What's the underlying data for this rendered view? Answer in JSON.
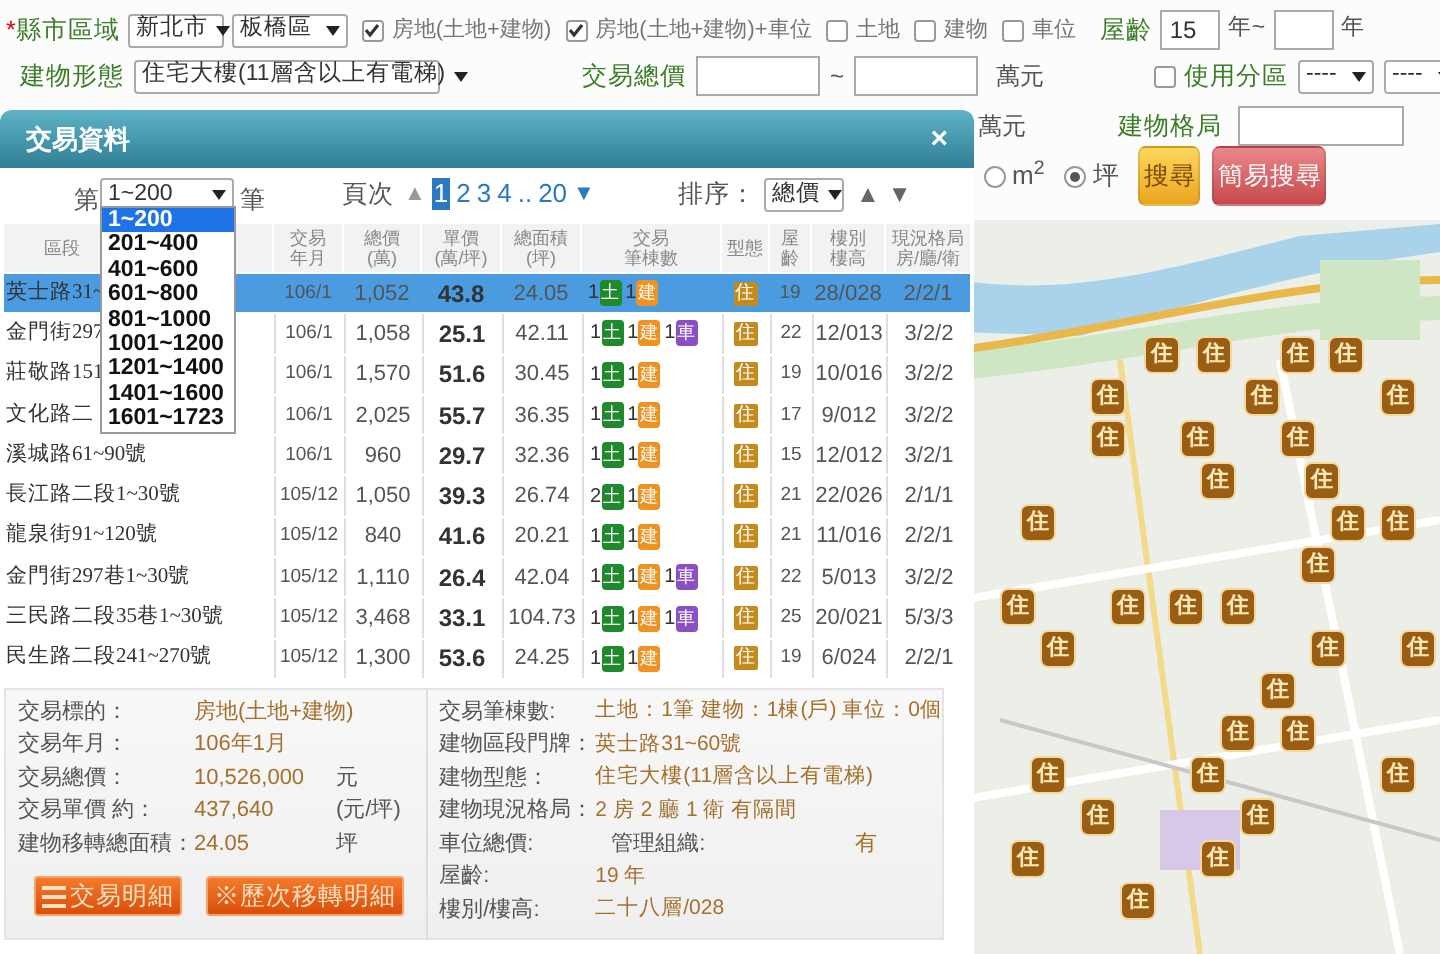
{
  "filters": {
    "region": {
      "label": "縣市區域",
      "required_mark": "*",
      "city": "新北市",
      "district": "板橋區"
    },
    "types": [
      {
        "label": "房地(土地+建物)",
        "checked": true
      },
      {
        "label": "房地(土地+建物)+車位",
        "checked": true
      },
      {
        "label": "土地",
        "checked": false
      },
      {
        "label": "建物",
        "checked": false
      },
      {
        "label": "車位",
        "checked": false
      }
    ],
    "age": {
      "label": "屋齡",
      "from": "15",
      "mid_unit": "年~",
      "unit": "年"
    },
    "building_type": {
      "label": "建物形態",
      "value": "住宅大樓(11層含以上有電梯)"
    },
    "total_price": {
      "label": "交易總價",
      "sep": "~",
      "unit": "萬元"
    },
    "zoning": {
      "label": "使用分區",
      "checked": false,
      "select_1": "----",
      "select_2": "----"
    },
    "hidden_unit": "萬元",
    "layout": {
      "label": "建物格局"
    },
    "area_units": [
      {
        "label": "m$^{2}$",
        "selected": false
      },
      {
        "label": "坪",
        "selected": true
      }
    ],
    "buttons": [
      {
        "label": "搜尋",
        "kind": "search"
      },
      {
        "label": "簡易搜尋",
        "kind": "simple"
      }
    ]
  },
  "panel": {
    "title": "交易資料",
    "close": "×",
    "range": {
      "prefix": "第",
      "value": "1~200",
      "suffix": "筆",
      "options": [
        {
          "label": "1~200",
          "selected": true
        },
        {
          "label": "201~400",
          "selected": false
        },
        {
          "label": "401~600",
          "selected": false
        },
        {
          "label": "601~800",
          "selected": false
        },
        {
          "label": "801~1000",
          "selected": false
        },
        {
          "label": "1001~1200",
          "selected": false
        },
        {
          "label": "1201~1400",
          "selected": false
        },
        {
          "label": "1401~1600",
          "selected": false
        },
        {
          "label": "1601~1723",
          "selected": false
        }
      ]
    },
    "pager": {
      "label": "頁次",
      "up": "▲",
      "down": "▼",
      "pages": [
        {
          "label": "1",
          "selected": true
        },
        {
          "label": "2",
          "selected": false
        },
        {
          "label": "3",
          "selected": false
        },
        {
          "label": "4",
          "selected": false
        },
        {
          "label": "..",
          "selected": false
        },
        {
          "label": "20",
          "selected": false
        }
      ]
    },
    "sort": {
      "label": "排序：",
      "value": "總價",
      "up": "▲",
      "down": "▼"
    },
    "table": {
      "columns": [
        {
          "lines": [
            "區段"
          ]
        },
        {
          "lines": [
            "交易",
            "年月"
          ]
        },
        {
          "lines": [
            "總價",
            "(萬)"
          ]
        },
        {
          "lines": [
            "單價",
            "(萬/坪)"
          ]
        },
        {
          "lines": [
            "總面積",
            "(坪)"
          ]
        },
        {
          "lines": [
            "交易",
            "筆棟數"
          ]
        },
        {
          "lines": [
            "型態"
          ]
        },
        {
          "lines": [
            "屋",
            "齡"
          ]
        },
        {
          "lines": [
            "樓別",
            "樓高"
          ]
        },
        {
          "lines": [
            "現況格局",
            "房/廳/衛"
          ]
        }
      ],
      "rows": [
        {
          "selected": true,
          "cells": [
            "英士路31~",
            "106/1",
            "1,052",
            "43.8",
            "24.05"
          ],
          "counts": [
            {
              "n": "1",
              "kind": "land",
              "label": "土"
            },
            {
              "n": "1",
              "kind": "building",
              "label": "建"
            }
          ],
          "type": "住",
          "rest": [
            "19",
            "28/028",
            "2/2/1"
          ]
        },
        {
          "selected": false,
          "cells": [
            "金門街297",
            "106/1",
            "1,058",
            "25.1",
            "42.11"
          ],
          "counts": [
            {
              "n": "1",
              "kind": "land",
              "label": "土"
            },
            {
              "n": "1",
              "kind": "building",
              "label": "建"
            },
            {
              "n": "1",
              "kind": "parking",
              "label": "車"
            }
          ],
          "type": "住",
          "rest": [
            "22",
            "12/013",
            "3/2/2"
          ]
        },
        {
          "selected": false,
          "cells": [
            "莊敬路151",
            "106/1",
            "1,570",
            "51.6",
            "30.45"
          ],
          "counts": [
            {
              "n": "1",
              "kind": "land",
              "label": "土"
            },
            {
              "n": "1",
              "kind": "building",
              "label": "建"
            }
          ],
          "type": "住",
          "rest": [
            "19",
            "10/016",
            "3/2/2"
          ]
        },
        {
          "selected": false,
          "cells": [
            "文化路二",
            "106/1",
            "2,025",
            "55.7",
            "36.35"
          ],
          "counts": [
            {
              "n": "1",
              "kind": "land",
              "label": "土"
            },
            {
              "n": "1",
              "kind": "building",
              "label": "建"
            }
          ],
          "type": "住",
          "rest": [
            "17",
            "9/012",
            "3/2/2"
          ]
        },
        {
          "selected": false,
          "cells": [
            "溪城路61~90號",
            "106/1",
            "960",
            "29.7",
            "32.36"
          ],
          "counts": [
            {
              "n": "1",
              "kind": "land",
              "label": "土"
            },
            {
              "n": "1",
              "kind": "building",
              "label": "建"
            }
          ],
          "type": "住",
          "rest": [
            "15",
            "12/012",
            "3/2/1"
          ]
        },
        {
          "selected": false,
          "cells": [
            "長江路二段1~30號",
            "105/12",
            "1,050",
            "39.3",
            "26.74"
          ],
          "counts": [
            {
              "n": "2",
              "kind": "land",
              "label": "土"
            },
            {
              "n": "1",
              "kind": "building",
              "label": "建"
            }
          ],
          "type": "住",
          "rest": [
            "21",
            "22/026",
            "2/1/1"
          ]
        },
        {
          "selected": false,
          "cells": [
            "龍泉街91~120號",
            "105/12",
            "840",
            "41.6",
            "20.21"
          ],
          "counts": [
            {
              "n": "1",
              "kind": "land",
              "label": "土"
            },
            {
              "n": "1",
              "kind": "building",
              "label": "建"
            }
          ],
          "type": "住",
          "rest": [
            "21",
            "11/016",
            "2/2/1"
          ]
        },
        {
          "selected": false,
          "cells": [
            "金門街297巷1~30號",
            "105/12",
            "1,110",
            "26.4",
            "42.04"
          ],
          "counts": [
            {
              "n": "1",
              "kind": "land",
              "label": "土"
            },
            {
              "n": "1",
              "kind": "building",
              "label": "建"
            },
            {
              "n": "1",
              "kind": "parking",
              "label": "車"
            }
          ],
          "type": "住",
          "rest": [
            "22",
            "5/013",
            "3/2/2"
          ]
        },
        {
          "selected": false,
          "cells": [
            "三民路二段35巷1~30號",
            "105/12",
            "3,468",
            "33.1",
            "104.73"
          ],
          "counts": [
            {
              "n": "1",
              "kind": "land",
              "label": "土"
            },
            {
              "n": "1",
              "kind": "building",
              "label": "建"
            },
            {
              "n": "1",
              "kind": "parking",
              "label": "車"
            }
          ],
          "type": "住",
          "rest": [
            "25",
            "20/021",
            "5/3/3"
          ]
        },
        {
          "selected": false,
          "cells": [
            "民生路二段241~270號",
            "105/12",
            "1,300",
            "53.6",
            "24.25"
          ],
          "counts": [
            {
              "n": "1",
              "kind": "land",
              "label": "土"
            },
            {
              "n": "1",
              "kind": "building",
              "label": "建"
            }
          ],
          "type": "住",
          "rest": [
            "19",
            "6/024",
            "2/2/1"
          ]
        }
      ]
    },
    "detail": {
      "left": [
        {
          "label": "交易標的：",
          "value": "房地(土地+建物)"
        },
        {
          "label": "交易年月：",
          "value": "106年1月"
        },
        {
          "label": "交易總價：",
          "value": "10,526,000",
          "unit": "元"
        },
        {
          "label": "交易單價 約：",
          "value": "437,640",
          "unit": "(元/坪)"
        },
        {
          "label": "建物移轉總面積：",
          "value": "24.05",
          "unit": "坪"
        }
      ],
      "right": [
        {
          "label": "交易筆棟數:",
          "value": "土地：1筆 建物：1棟(戶) 車位：0個"
        },
        {
          "label": "建物區段門牌：",
          "value": "英士路31~60號"
        },
        {
          "label": "建物型態：",
          "value": "住宅大樓(11層含以上有電梯)"
        },
        {
          "label": "建物現況格局：",
          "value": "2 房 2 廳 1 衛 有隔間"
        },
        {
          "label": "車位總價:",
          "extra_label": "管理組織:",
          "extra_value": "有"
        },
        {
          "label": "屋齡:",
          "value": "19 年"
        },
        {
          "label": "樓別/樓高:",
          "value": "二十八層/028"
        }
      ],
      "buttons": [
        {
          "label": "交易明細",
          "kind": "list"
        },
        {
          "label": "※歷次移轉明細",
          "kind": "plain"
        }
      ]
    }
  },
  "map": {
    "markers": [
      {
        "label": "住"
      },
      {
        "label": "住"
      },
      {
        "label": "住"
      },
      {
        "label": "住"
      },
      {
        "label": "住"
      },
      {
        "label": "住"
      },
      {
        "label": "住"
      },
      {
        "label": "住"
      },
      {
        "label": "住"
      },
      {
        "label": "住"
      },
      {
        "label": "住"
      },
      {
        "label": "住"
      },
      {
        "label": "住"
      },
      {
        "label": "住"
      },
      {
        "label": "住"
      },
      {
        "label": "住"
      },
      {
        "label": "住"
      },
      {
        "label": "住"
      },
      {
        "label": "住"
      },
      {
        "label": "住"
      },
      {
        "label": "住"
      },
      {
        "label": "住"
      },
      {
        "label": "住"
      },
      {
        "label": "住"
      },
      {
        "label": "住"
      },
      {
        "label": "住"
      },
      {
        "label": "住"
      },
      {
        "label": "住"
      },
      {
        "label": "住"
      },
      {
        "label": "住"
      },
      {
        "label": "住"
      },
      {
        "label": "住"
      },
      {
        "label": "住"
      },
      {
        "label": "住"
      }
    ]
  }
}
